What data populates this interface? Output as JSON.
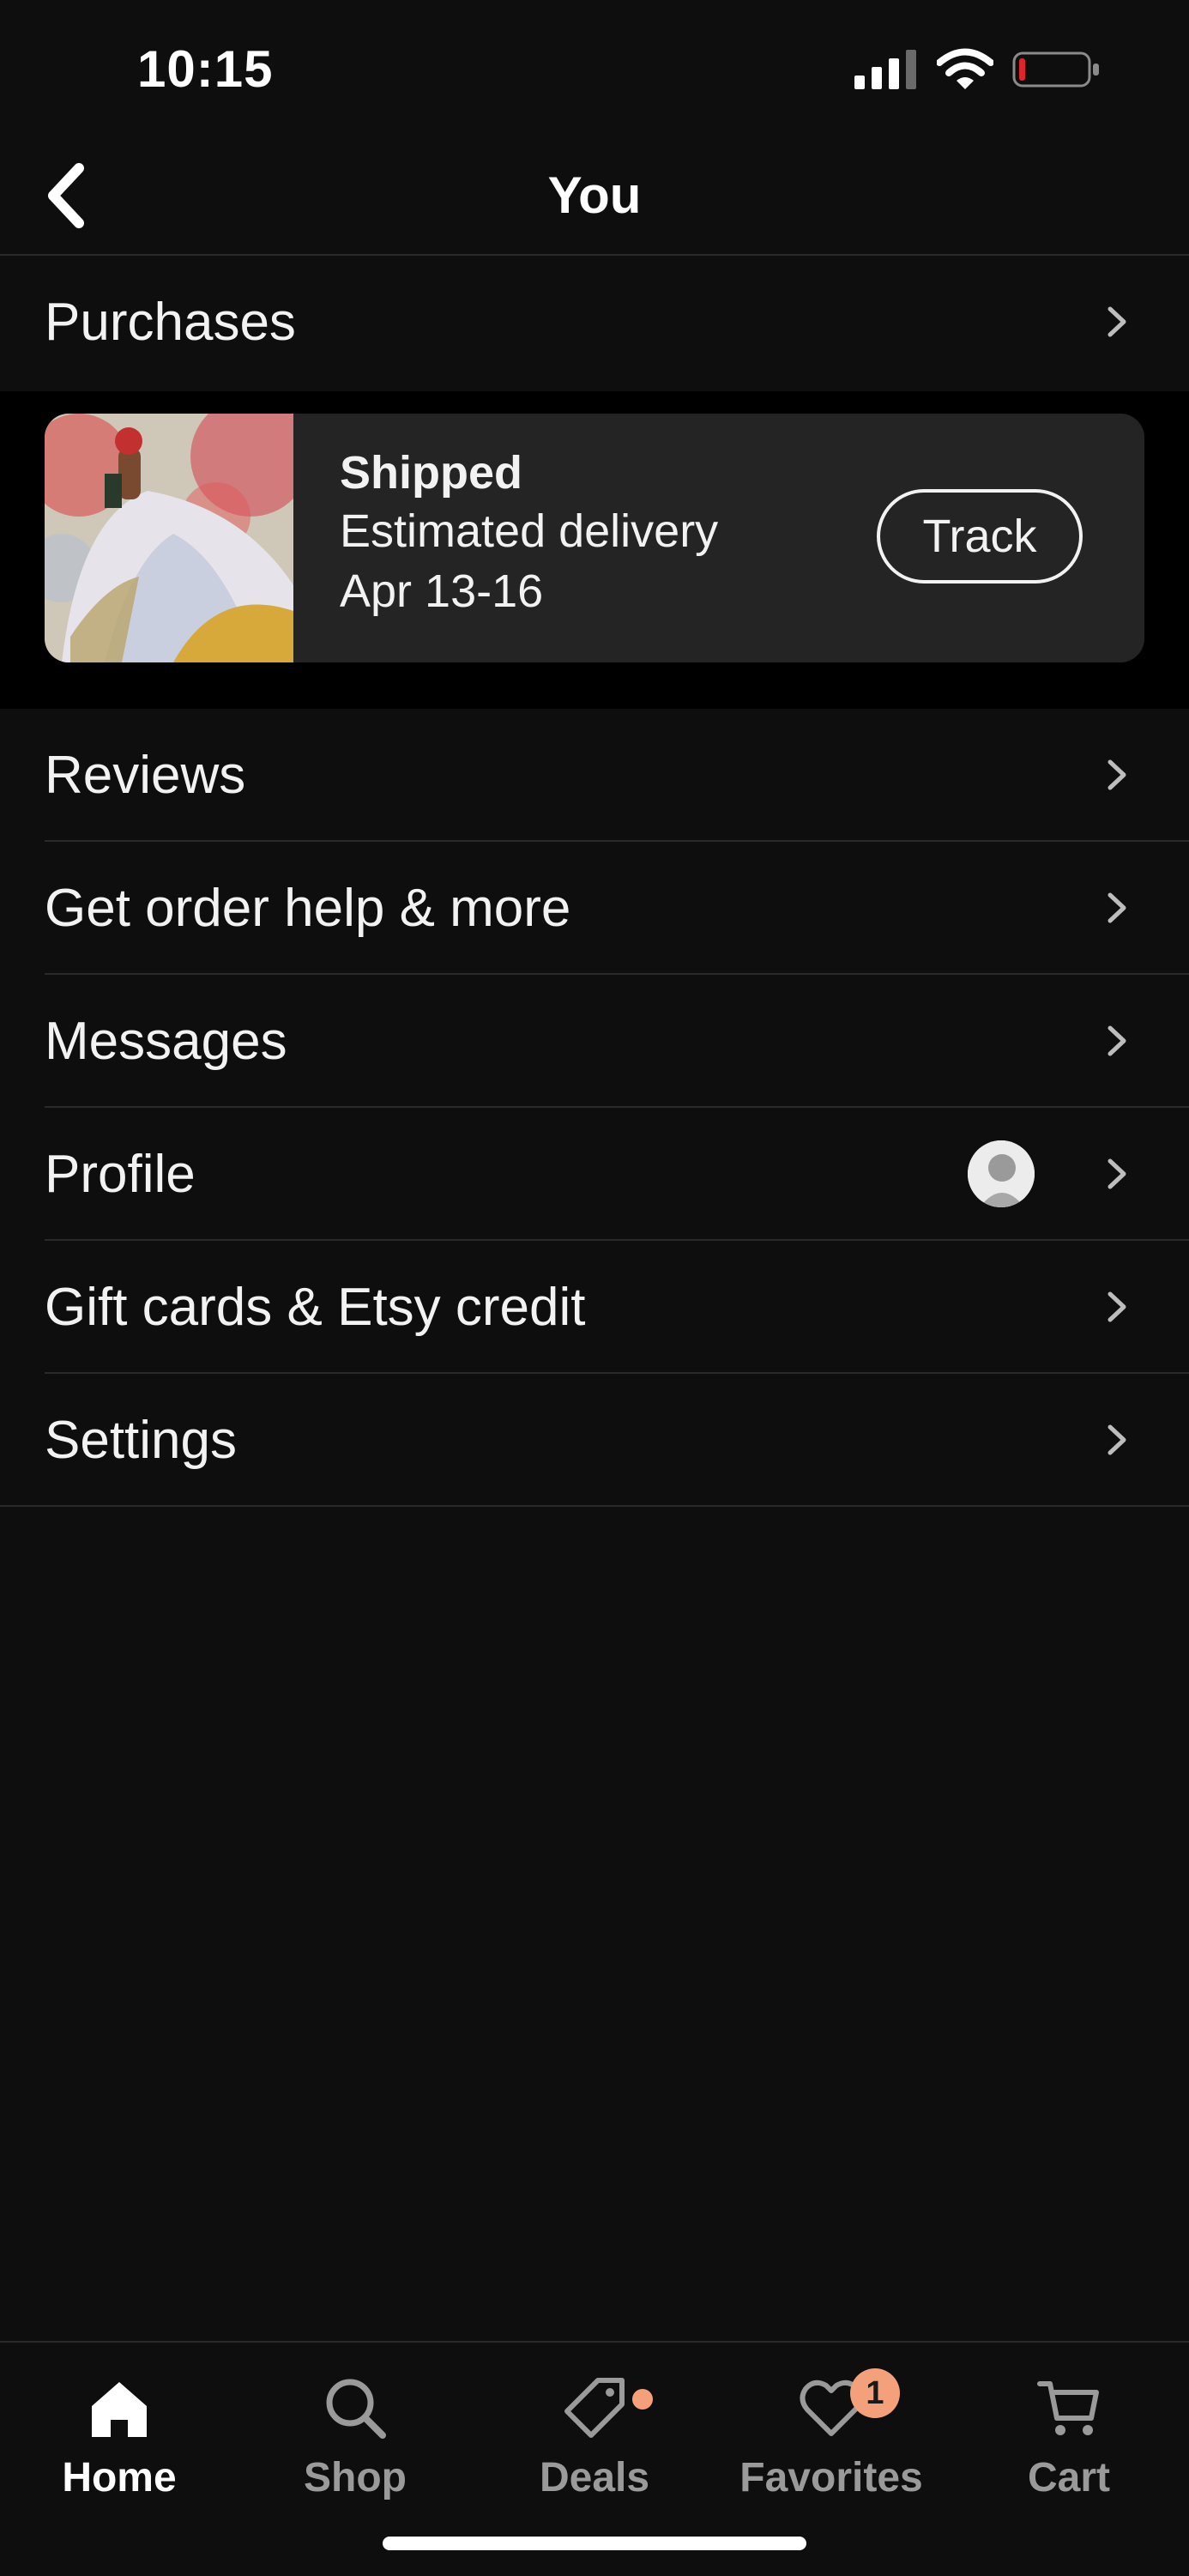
{
  "status_bar": {
    "time": "10:15",
    "signal_icon": "signal-bars-icon",
    "wifi_icon": "wifi-icon",
    "battery_icon": "battery-low-icon",
    "battery_color": "#e0242a"
  },
  "header": {
    "title": "You",
    "back_icon": "chevron-left-icon"
  },
  "purchases": {
    "label": "Purchases",
    "order": {
      "status": "Shipped",
      "line1": "Estimated delivery",
      "line2": "Apr 13-16",
      "track_label": "Track"
    }
  },
  "menu": {
    "items": [
      {
        "label": "Reviews"
      },
      {
        "label": "Get order help & more"
      },
      {
        "label": "Messages"
      },
      {
        "label": "Profile"
      },
      {
        "label": "Gift cards & Etsy credit"
      },
      {
        "label": "Settings"
      }
    ]
  },
  "bottom_nav": {
    "items": [
      {
        "label": "Home",
        "icon": "home-icon",
        "active": true
      },
      {
        "label": "Shop",
        "icon": "search-icon",
        "active": false
      },
      {
        "label": "Deals",
        "icon": "tag-icon",
        "active": false
      },
      {
        "label": "Favorites",
        "icon": "heart-icon",
        "active": false,
        "badge": "1"
      },
      {
        "label": "Cart",
        "icon": "cart-icon",
        "active": false
      }
    ]
  },
  "colors": {
    "background": "#0e0e0e",
    "card": "#242424",
    "accent": "#f4a07a"
  }
}
